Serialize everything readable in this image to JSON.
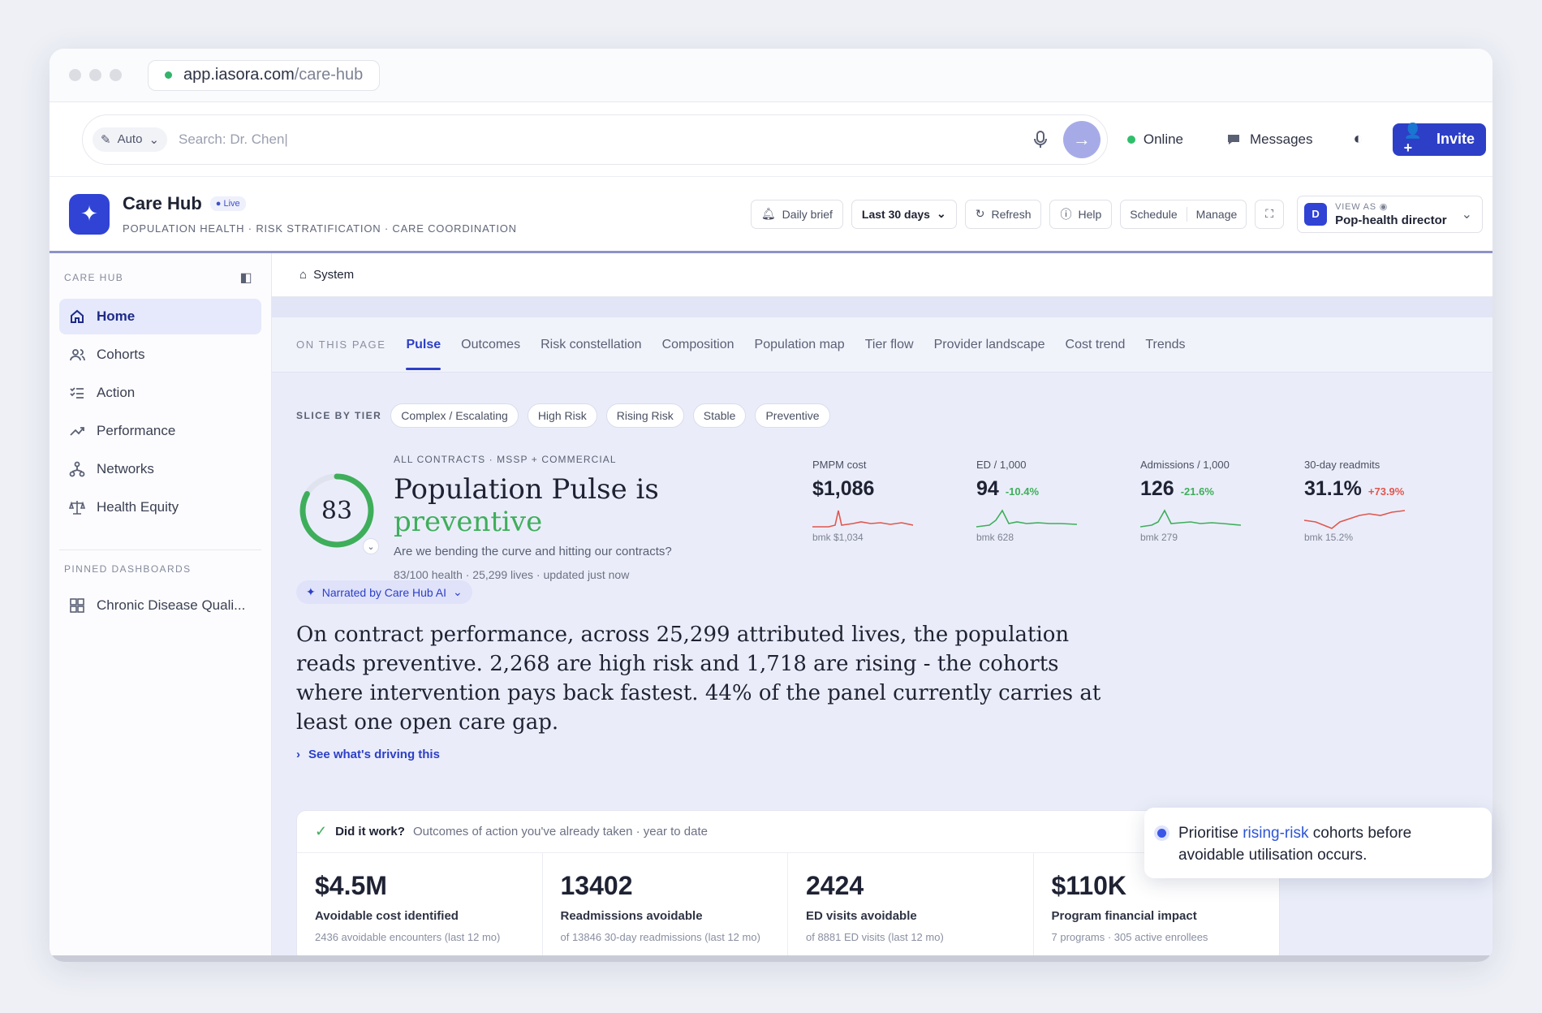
{
  "browser": {
    "url_host": "app.iasora.com",
    "url_path": "/care-hub"
  },
  "topbar": {
    "mode": "Auto",
    "search_placeholder": "Search: Dr. Chen|",
    "status": "Online",
    "messages": "Messages",
    "invite": "Invite"
  },
  "hub": {
    "title": "Care Hub",
    "badge": "Live",
    "subtitle": "POPULATION HEALTH · RISK STRATIFICATION · CARE COORDINATION",
    "buttons": {
      "daily_brief": "Daily brief",
      "range": "Last 30 days",
      "refresh": "Refresh",
      "help": "Help",
      "schedule": "Schedule",
      "manage": "Manage"
    },
    "view_as_label": "VIEW AS",
    "view_as_avatar": "D",
    "view_as_role": "Pop-health director"
  },
  "sidebar": {
    "section": "CARE HUB",
    "items": [
      {
        "label": "Home"
      },
      {
        "label": "Cohorts"
      },
      {
        "label": "Action"
      },
      {
        "label": "Performance"
      },
      {
        "label": "Networks"
      },
      {
        "label": "Health Equity"
      }
    ],
    "pinned_label": "PINNED DASHBOARDS",
    "pinned": [
      {
        "label": "Chronic Disease Quali..."
      }
    ]
  },
  "breadcrumb": "System",
  "tabs": {
    "label": "ON THIS PAGE",
    "items": [
      "Pulse",
      "Outcomes",
      "Risk constellation",
      "Composition",
      "Population map",
      "Tier flow",
      "Provider landscape",
      "Cost trend",
      "Trends"
    ]
  },
  "slice": {
    "label": "SLICE BY TIER",
    "chips": [
      "Complex / Escalating",
      "High Risk",
      "Rising Risk",
      "Stable",
      "Preventive"
    ]
  },
  "pulse": {
    "score": "83",
    "score_fraction": 0.83,
    "kicker": "ALL CONTRACTS · MSSP + COMMERCIAL",
    "title_a": "Population Pulse is ",
    "title_b": "preventive",
    "question": "Are we bending the curve and hitting our contracts?",
    "meta": "83/100 health · 25,299 lives · updated just now"
  },
  "kpis": [
    {
      "label": "PMPM cost",
      "value": "$1,086",
      "delta": "",
      "bench": "bmk $1,034",
      "color": "#e0574f"
    },
    {
      "label": "ED / 1,000",
      "value": "94",
      "delta": "-10.4%",
      "bench": "bmk 628",
      "color": "#3fae5b"
    },
    {
      "label": "Admissions / 1,000",
      "value": "126",
      "delta": "-21.6%",
      "bench": "bmk 279",
      "color": "#3fae5b"
    },
    {
      "label": "30-day readmits",
      "value": "31.1%",
      "delta": "+73.9%",
      "bench": "bmk 15.2%",
      "color": "#e0574f"
    }
  ],
  "narration": {
    "pill": "Narrated by Care Hub AI",
    "text": "On contract performance, across 25,299 attributed lives, the population reads preventive. 2,268 are high risk and 1,718 are rising - the cohorts where intervention pays back fastest. 44% of the panel currently carries at least one open care gap.",
    "link": "See what's driving this"
  },
  "did_it_work": {
    "title": "Did it work?",
    "subtitle": "Outcomes of action you've already taken · year to date",
    "stats": [
      {
        "value": "$4.5M",
        "label": "Avoidable cost identified",
        "sub": "2436 avoidable encounters (last 12 mo)"
      },
      {
        "value": "13402",
        "label": "Readmissions avoidable",
        "sub": "of 13846 30-day readmissions (last 12 mo)"
      },
      {
        "value": "2424",
        "label": "ED visits avoidable",
        "sub": "of 8881 ED visits (last 12 mo)"
      },
      {
        "value": "$110K",
        "label": "Program financial impact",
        "sub": "7 programs · 305 active enrollees"
      }
    ]
  },
  "toast": {
    "pre": "Prioritise ",
    "highlight": "rising-risk",
    "post": " cohorts before avoidable utilisation occurs."
  }
}
